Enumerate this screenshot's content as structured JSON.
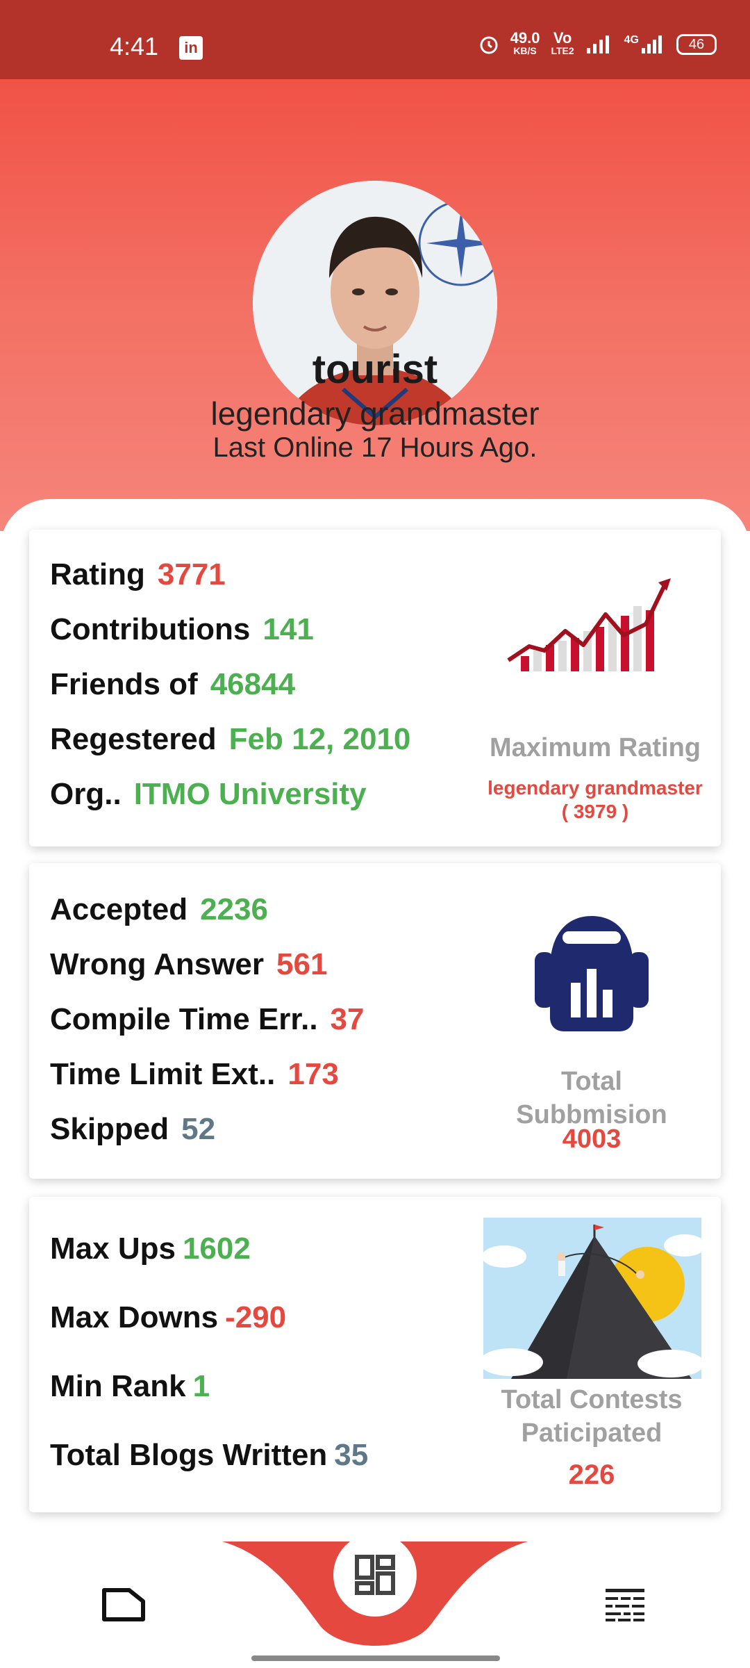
{
  "status_bar": {
    "time": "4:41",
    "linkedin_glyph": "in",
    "net_speed": "49.0",
    "net_unit": "KB/S",
    "volte_top": "Vo",
    "volte_bottom": "LTE2",
    "network": "4G",
    "battery": "46"
  },
  "profile": {
    "username": "tourist",
    "rank": "legendary grandmaster",
    "last_online": "Last Online 17 Hours Ago."
  },
  "info_card": {
    "rating_label": "Rating",
    "rating_value": "3771",
    "contributions_label": "Contributions",
    "contributions_value": "141",
    "friends_label": "Friends of",
    "friends_value": "46844",
    "registered_label": "Regestered",
    "registered_value": "Feb 12, 2010",
    "org_label": "Org..",
    "org_value": "ITMO University",
    "max_rating_title": "Maximum Rating",
    "max_rating_rank": "legendary grandmaster",
    "max_rating_value": "( 3979 )"
  },
  "submissions_card": {
    "accepted_label": "Accepted",
    "accepted_value": "2236",
    "wrong_label": "Wrong Answer",
    "wrong_value": "561",
    "compile_label": "Compile Time Err..",
    "compile_value": "37",
    "tle_label": "Time Limit Ext..",
    "tle_value": "173",
    "skipped_label": "Skipped",
    "skipped_value": "52",
    "total_title_1": "Total",
    "total_title_2": "Subbmision",
    "total_value": "4003"
  },
  "contests_card": {
    "max_ups_label": "Max Ups",
    "max_ups_value": "1602",
    "max_downs_label": "Max Downs",
    "max_downs_value": "-290",
    "min_rank_label": "Min Rank",
    "min_rank_value": "1",
    "blogs_label": "Total Blogs Written",
    "blogs_value": "35",
    "contests_title_1": "Total Contests",
    "contests_title_2": "Paticipated",
    "contests_value": "226"
  },
  "nav": {
    "left_icon": "folder-icon",
    "center_icon": "dashboard-icon",
    "right_icon": "list-icon"
  },
  "colors": {
    "status_bar": "#b3322a",
    "header_top": "#f15246",
    "accent_red": "#e5483e",
    "accent_green": "#4caf50",
    "blue_gray": "#5e7888",
    "submission_icon": "#1f2a6e"
  }
}
